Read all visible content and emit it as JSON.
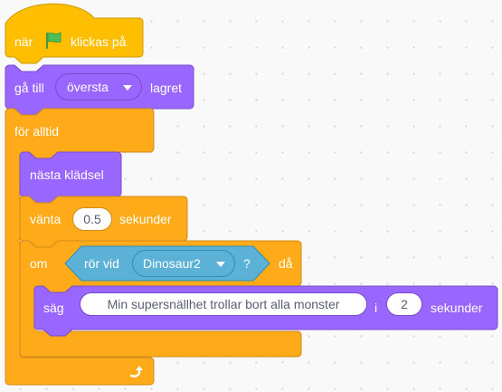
{
  "colors": {
    "events": "#ffbf00",
    "looks": "#9966ff",
    "control": "#ffab19",
    "sensing": "#5cb1d6",
    "background": "#f9f9f9"
  },
  "script": {
    "hat": {
      "label_before": "när",
      "flag_icon": "green-flag-icon",
      "label_after": "klickas på"
    },
    "goto_layer": {
      "label_before": "gå till",
      "dropdown_value": "översta",
      "label_after": "lagret"
    },
    "forever": {
      "label": "för alltid",
      "loop_icon": "loop-arrow-icon"
    },
    "next_costume": {
      "label": "nästa klädsel"
    },
    "wait": {
      "label_before": "vänta",
      "value": "0.5",
      "label_after": "sekunder"
    },
    "if_block": {
      "label_before": "om",
      "label_after": "då"
    },
    "touching": {
      "label_before": "rör vid",
      "dropdown_value": "Dinosaur2",
      "label_after": "?"
    },
    "say_for": {
      "label_before": "säg",
      "message": "Min supersnällhet trollar bort alla monster",
      "label_middle": "i",
      "seconds": "2",
      "label_after": "sekunder"
    }
  }
}
